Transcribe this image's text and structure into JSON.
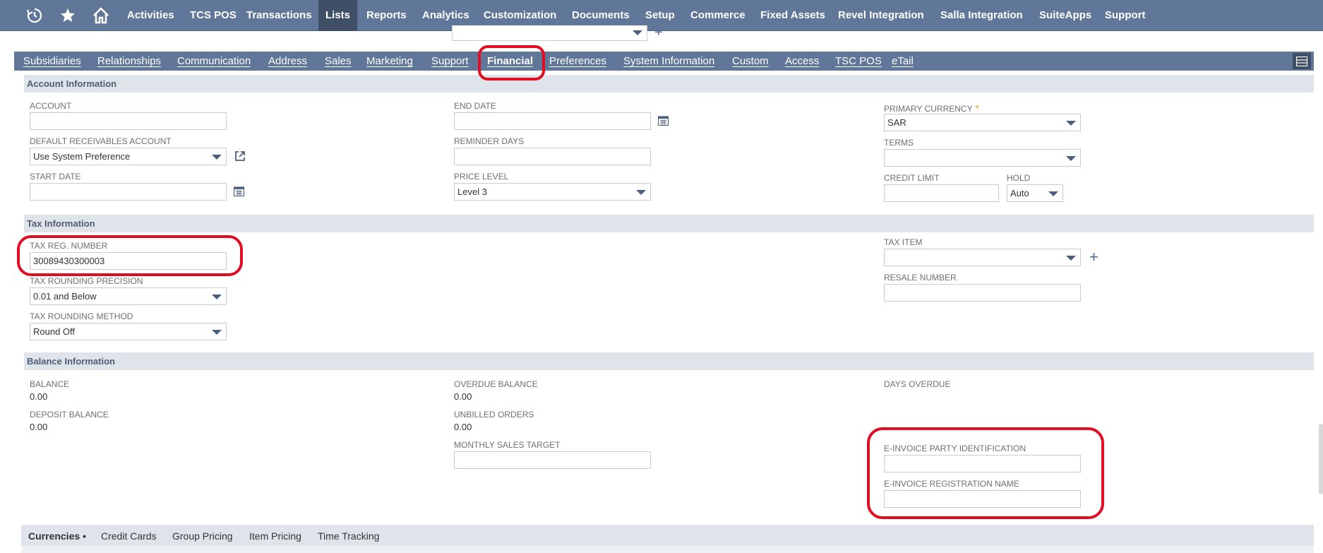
{
  "topnav": {
    "icons": [
      "history-icon",
      "star-icon",
      "home-icon"
    ],
    "items": [
      {
        "label": "Activities"
      },
      {
        "label": "TCS POS"
      },
      {
        "label": "Transactions"
      },
      {
        "label": "Lists",
        "active": true
      },
      {
        "label": "Reports"
      },
      {
        "label": "Analytics"
      },
      {
        "label": "Customization"
      },
      {
        "label": "Documents"
      },
      {
        "label": "Setup"
      },
      {
        "label": "Commerce"
      },
      {
        "label": "Fixed Assets"
      },
      {
        "label": "Revel Integration"
      },
      {
        "label": "Salla Integration"
      },
      {
        "label": "SuiteApps"
      },
      {
        "label": "Support"
      }
    ],
    "bg_color": "#607799",
    "active_color": "#3f4f66"
  },
  "subtabs": {
    "items": [
      {
        "label": "Subsidiaries"
      },
      {
        "label": "Relationships"
      },
      {
        "label": "Communication"
      },
      {
        "label": "Address"
      },
      {
        "label": "Sales"
      },
      {
        "label": "Marketing"
      },
      {
        "label": "Support"
      },
      {
        "label": "Financial",
        "active": true
      },
      {
        "label": "Preferences"
      },
      {
        "label": "System Information"
      },
      {
        "label": "Custom"
      },
      {
        "label": "Access"
      },
      {
        "label": "TSC POS"
      },
      {
        "label": "eTail"
      }
    ]
  },
  "account_info": {
    "title": "Account Information",
    "account": {
      "label": "ACCOUNT",
      "value": ""
    },
    "default_receivables": {
      "label": "DEFAULT RECEIVABLES ACCOUNT",
      "value": "Use System Preference"
    },
    "start_date": {
      "label": "START DATE",
      "value": ""
    },
    "end_date": {
      "label": "END DATE",
      "value": ""
    },
    "reminder_days": {
      "label": "REMINDER DAYS",
      "value": ""
    },
    "price_level": {
      "label": "PRICE LEVEL",
      "value": "Level 3"
    },
    "primary_currency": {
      "label": "PRIMARY CURRENCY",
      "value": "SAR",
      "required_mark": "*"
    },
    "terms": {
      "label": "TERMS",
      "value": ""
    },
    "credit_limit": {
      "label": "CREDIT LIMIT",
      "value": ""
    },
    "hold": {
      "label": "HOLD",
      "value": "Auto"
    }
  },
  "tax_info": {
    "title": "Tax Information",
    "tax_reg_number": {
      "label": "TAX REG. NUMBER",
      "value": "30089430300003"
    },
    "tax_rounding_precision": {
      "label": "TAX ROUNDING PRECISION",
      "value": "0.01 and Below"
    },
    "tax_rounding_method": {
      "label": "TAX ROUNDING METHOD",
      "value": "Round Off"
    },
    "tax_item": {
      "label": "TAX ITEM",
      "value": ""
    },
    "resale_number": {
      "label": "RESALE NUMBER",
      "value": ""
    }
  },
  "balance_info": {
    "title": "Balance Information",
    "balance": {
      "label": "BALANCE",
      "value": "0.00"
    },
    "deposit_balance": {
      "label": "DEPOSIT BALANCE",
      "value": "0.00"
    },
    "overdue_balance": {
      "label": "OVERDUE BALANCE",
      "value": "0.00"
    },
    "unbilled_orders": {
      "label": "UNBILLED ORDERS",
      "value": "0.00"
    },
    "monthly_sales_target": {
      "label": "MONTHLY SALES TARGET",
      "value": ""
    },
    "days_overdue": {
      "label": "DAYS OVERDUE"
    },
    "einvoice_party_id": {
      "label": "E-INVOICE PARTY IDENTIFICATION",
      "value": ""
    },
    "einvoice_reg_name": {
      "label": "E-INVOICE REGISTRATION NAME",
      "value": ""
    }
  },
  "bottom_tabs": {
    "items": [
      {
        "label": "Currencies",
        "active": true,
        "suffix": "•"
      },
      {
        "label": "Credit Cards"
      },
      {
        "label": "Group Pricing"
      },
      {
        "label": "Item Pricing"
      },
      {
        "label": "Time Tracking"
      }
    ]
  },
  "colors": {
    "highlight": "#e00d23",
    "section_bg": "#dfe4eb",
    "section_text": "#4f5d73",
    "required": "#e0a63f"
  }
}
